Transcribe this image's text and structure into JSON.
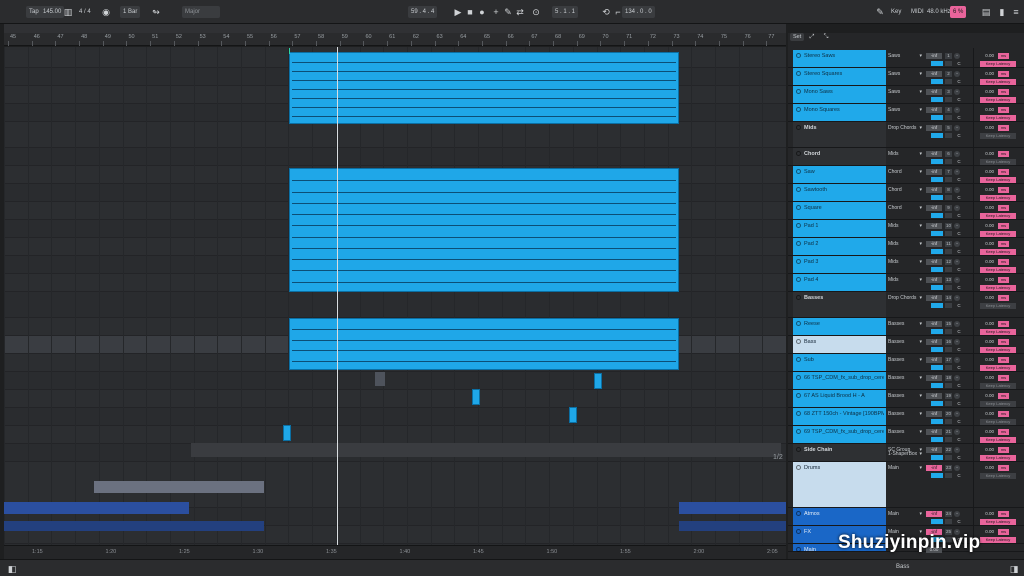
{
  "transport": {
    "tap": "Tap",
    "tempo": "145.00",
    "meter": "4 / 4",
    "quant": "1 Bar",
    "key_label": "Major",
    "position": "59 .  4 .  4",
    "loop_start": "5 .  1 .  1",
    "loop_len": "134 .  0 .  0",
    "key_btn": "Key",
    "midi_btn": "MIDI",
    "sample_rate": "48.0 kHz",
    "cpu": "6 %"
  },
  "ruler": {
    "bars": [
      "45",
      "46",
      "47",
      "48",
      "49",
      "50",
      "51",
      "52",
      "53",
      "54",
      "55",
      "56",
      "57",
      "58",
      "59",
      "60",
      "61",
      "62",
      "63",
      "64",
      "65",
      "66",
      "67",
      "68",
      "69",
      "70",
      "71",
      "72",
      "73",
      "74",
      "75",
      "76",
      "77"
    ]
  },
  "timebar": {
    "labels": [
      "1:15",
      "1:20",
      "1:25",
      "1:30",
      "1:35",
      "1:40",
      "1:45",
      "1:50",
      "1:55",
      "2:00",
      "2:05"
    ]
  },
  "page_indicator": "1/2",
  "set_label": "Set",
  "tracks": [
    {
      "name": "Stereo Saws",
      "route": "Saws",
      "vol": "-inf",
      "num": "1",
      "pan": "C",
      "delay": "0.00",
      "keep": "Keep Latency",
      "style": "blue"
    },
    {
      "name": "Stereo Squares",
      "route": "Saws",
      "vol": "-inf",
      "num": "2",
      "pan": "C",
      "delay": "0.00",
      "keep": "Keep Latency",
      "style": "blue"
    },
    {
      "name": "Mono Saws",
      "route": "Saws",
      "vol": "-inf",
      "num": "3",
      "pan": "C",
      "delay": "0.00",
      "keep": "Keep Latency",
      "style": "blue"
    },
    {
      "name": "Mono Squares",
      "route": "Saws",
      "vol": "-inf",
      "num": "4",
      "pan": "C",
      "delay": "0.00",
      "keep": "Keep Latency",
      "style": "blue"
    },
    {
      "name": "Mids",
      "route": "Drop Chords",
      "vol": "-inf",
      "num": "5",
      "pan": "C",
      "delay": "0.00",
      "keep": "Keep Latency",
      "style": "group"
    },
    {
      "name": "Chord",
      "route": "Mids",
      "vol": "-inf",
      "num": "6",
      "pan": "C",
      "delay": "0.00",
      "keep": "Keep Latency",
      "style": "group"
    },
    {
      "name": "Saw",
      "route": "Chord",
      "vol": "-inf",
      "num": "7",
      "pan": "C",
      "delay": "0.00",
      "keep": "Keep Latency",
      "style": "blue"
    },
    {
      "name": "Sawtooth",
      "route": "Chord",
      "vol": "-inf",
      "num": "8",
      "pan": "C",
      "delay": "0.00",
      "keep": "Keep Latency",
      "style": "blue"
    },
    {
      "name": "Square",
      "route": "Chord",
      "vol": "-inf",
      "num": "9",
      "pan": "C",
      "delay": "0.00",
      "keep": "Keep Latency",
      "style": "blue"
    },
    {
      "name": "Pad 1",
      "route": "Mids",
      "vol": "-inf",
      "num": "10",
      "pan": "C",
      "delay": "0.00",
      "keep": "Keep Latency",
      "style": "blue"
    },
    {
      "name": "Pad 2",
      "route": "Mids",
      "vol": "-inf",
      "num": "11",
      "pan": "C",
      "delay": "0.00",
      "keep": "Keep Latency",
      "style": "blue"
    },
    {
      "name": "Pad 3",
      "route": "Mids",
      "vol": "-inf",
      "num": "12",
      "pan": "C",
      "delay": "0.00",
      "keep": "Keep Latency",
      "style": "blue"
    },
    {
      "name": "Pad 4",
      "route": "Mids",
      "vol": "-inf",
      "num": "13",
      "pan": "C",
      "delay": "0.00",
      "keep": "Keep Latency",
      "style": "blue"
    },
    {
      "name": "Basses",
      "route": "Drop Chords",
      "vol": "-inf",
      "num": "14",
      "pan": "C",
      "delay": "0.00",
      "keep": "Keep Latency",
      "style": "group"
    },
    {
      "name": "Reese",
      "route": "Basses",
      "vol": "-inf",
      "num": "15",
      "pan": "C",
      "delay": "0.00",
      "keep": "Keep Latency",
      "style": "blue"
    },
    {
      "name": "Bass",
      "route": "Basses",
      "vol": "-inf",
      "num": "16",
      "pan": "C",
      "delay": "0.00",
      "keep": "Keep Latency",
      "style": "light"
    },
    {
      "name": "Sub",
      "route": "Basses",
      "vol": "-inf",
      "num": "17",
      "pan": "C",
      "delay": "0.00",
      "keep": "Keep Latency",
      "style": "blue"
    },
    {
      "name": "66 TSP_CDM_fx_sub_drop_cereal",
      "route": "Basses",
      "vol": "-inf",
      "num": "18",
      "pan": "C",
      "delay": "0.00",
      "keep": "Keep Latency",
      "style": "blue"
    },
    {
      "name": "67 AS Liquid Brood H - A",
      "route": "Basses",
      "vol": "-inf",
      "num": "19",
      "pan": "C",
      "delay": "0.00",
      "keep": "Keep Latency",
      "style": "blue"
    },
    {
      "name": "68 ZTT 150ch - Vintage [190BPM G]",
      "route": "Basses",
      "vol": "-inf",
      "num": "20",
      "pan": "C",
      "delay": "0.00",
      "keep": "Keep Latency",
      "style": "blue"
    },
    {
      "name": "69 TSP_CDM_fx_sub_drop_cereal",
      "route": "Basses",
      "vol": "-inf",
      "num": "21",
      "pan": "C",
      "delay": "0.00",
      "keep": "Keep Latency",
      "style": "blue"
    },
    {
      "name": "Side Chain",
      "route": "SC Group",
      "vol": "-inf",
      "num": "22",
      "pan": "C",
      "delay": "0.00",
      "keep": "Keep Latency",
      "style": "group"
    },
    {
      "name": "Drums",
      "route": "Main",
      "vol": "-inf",
      "num": "23",
      "pan": "C",
      "delay": "0.00",
      "keep": "Keep Latency",
      "style": "light"
    },
    {
      "name": "Atmos",
      "route": "Main",
      "vol": "-inf",
      "num": "24",
      "pan": "C",
      "delay": "0.00",
      "keep": "Keep Latency",
      "style": "blue2"
    },
    {
      "name": "FX",
      "route": "Main",
      "vol": "-inf",
      "num": "25",
      "pan": "C",
      "delay": "0.00",
      "keep": "Keep Latency",
      "style": "blue2"
    },
    {
      "name": "Main",
      "route": "",
      "vol": "0.00",
      "num": "",
      "pan": "",
      "delay": "",
      "keep": "",
      "style": "blue2"
    }
  ],
  "sidechain_route": "1-ShaperBox",
  "statusbar": {
    "track_name": "Bass"
  },
  "watermark": "Shuziyinpin.vip",
  "colors": {
    "clip": "#1fa7e8",
    "accent_pink": "#e9649b",
    "background": "#2b2d30"
  }
}
